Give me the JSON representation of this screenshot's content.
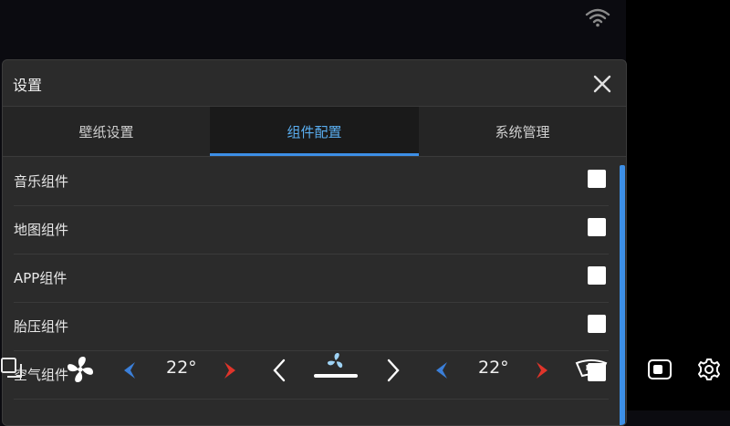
{
  "status_bar": {
    "wifi_icon": "wifi-icon"
  },
  "dialog": {
    "title": "设置",
    "close_icon": "close-icon",
    "tabs": [
      {
        "label": "壁纸设置",
        "active": false
      },
      {
        "label": "组件配置",
        "active": true
      },
      {
        "label": "系统管理",
        "active": false
      }
    ],
    "items": [
      {
        "label": "音乐组件",
        "checked": false
      },
      {
        "label": "地图组件",
        "checked": false
      },
      {
        "label": "APP组件",
        "checked": false
      },
      {
        "label": "胎压组件",
        "checked": false
      },
      {
        "label": "空气组件",
        "checked": false
      }
    ]
  },
  "climate_bar": {
    "left_temp": "22°",
    "right_temp": "22°",
    "icons": [
      "windows-icon",
      "fan-icon",
      "temp-down-icon",
      "temp-up-icon",
      "chevron-left-icon",
      "fan-level-icon",
      "chevron-right-icon",
      "windshield-defrost-icon",
      "toggle-icon",
      "gear-icon"
    ]
  },
  "colors": {
    "accent": "#3d8fe6",
    "cold": "#3b7fd9",
    "hot": "#e0342a"
  }
}
